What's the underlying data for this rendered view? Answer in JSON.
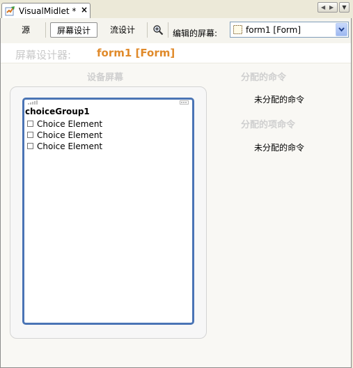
{
  "tab": {
    "title": "VisualMidlet *",
    "close": "×",
    "icon": "midlet-icon"
  },
  "window_controls": {
    "prev": "◀",
    "next": "▶",
    "menu": "▼"
  },
  "toolbar": {
    "source_label": "源",
    "screen_design_label": "屏幕设计",
    "flow_design_label": "流设计",
    "edited_screen_label": "编辑的屏幕:",
    "selected_screen": "form1 [Form]"
  },
  "designer": {
    "label": "屏幕设计器:",
    "form_name": "form1 [Form]",
    "device_screen_header": "设备屏幕",
    "assigned_commands_header": "分配的命令",
    "unassigned_commands_1": "未分配的命令",
    "assigned_item_commands_header": "分配的项命令",
    "unassigned_commands_2": "未分配的命令"
  },
  "device": {
    "group_title": "choiceGroup1",
    "choices": [
      "Choice Element",
      "Choice Element",
      "Choice Element"
    ]
  },
  "colors": {
    "accent": "#e08a2a",
    "screen_border": "#4a74b5",
    "header_gray": "#cfcfcf"
  }
}
